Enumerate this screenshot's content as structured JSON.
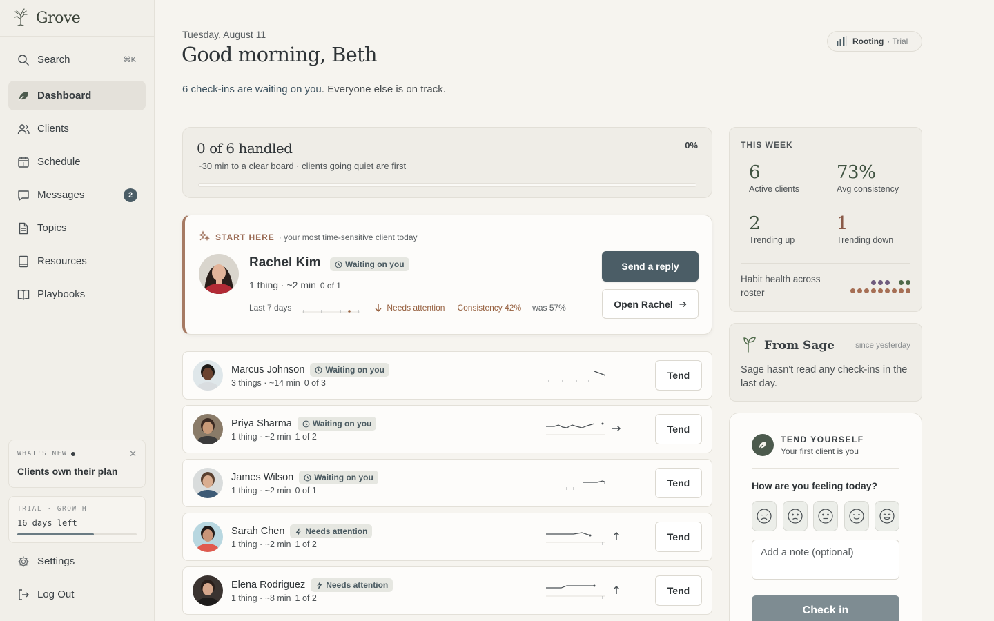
{
  "app": {
    "name": "Grove"
  },
  "sidebar": {
    "search": {
      "label": "Search",
      "shortcut": "⌘K"
    },
    "items": [
      {
        "label": "Dashboard",
        "icon": "leaf-icon",
        "active": true
      },
      {
        "label": "Clients",
        "icon": "users-icon"
      },
      {
        "label": "Schedule",
        "icon": "calendar-icon"
      },
      {
        "label": "Messages",
        "icon": "message-icon",
        "badge": "2"
      },
      {
        "label": "Topics",
        "icon": "document-icon"
      },
      {
        "label": "Resources",
        "icon": "tablet-icon"
      },
      {
        "label": "Playbooks",
        "icon": "book-icon"
      }
    ],
    "whats_new": {
      "label": "WHAT'S NEW",
      "title": "Clients own their plan"
    },
    "trial": {
      "label": "TRIAL · GROWTH",
      "days": "16 days left",
      "progress": 0.64
    },
    "settings": "Settings",
    "logout": "Log Out"
  },
  "header": {
    "date": "Tuesday, August 11",
    "greeting": "Good morning, Beth",
    "waiting_link": "6 check-ins are waiting on you",
    "waiting_rest": ". Everyone else is on track.",
    "plan": {
      "name": "Rooting",
      "tier": "· Trial"
    }
  },
  "progress": {
    "title": "0 of 6 handled",
    "subtitle": "~30 min to a clear board · clients going quiet are first",
    "percent": "0%",
    "value": 0
  },
  "start_here": {
    "label": "START HERE",
    "description": "· your most time-sensitive client today",
    "name": "Rachel Kim",
    "status": "Waiting on you",
    "meta": "1 thing · ~2 min",
    "of": "0 of 1",
    "last_days": "Last 7 days",
    "attention": "Needs attention",
    "consistency": "Consistency 42%",
    "was": "was 57%",
    "reply_button": "Send a reply",
    "open_button": "Open Rachel"
  },
  "clients": [
    {
      "name": "Marcus Johnson",
      "status": "Waiting on you",
      "status_type": "waiting",
      "meta": "3 things · ~14 min",
      "of": "0 of 3",
      "trend": "down",
      "tend": "Tend"
    },
    {
      "name": "Priya Sharma",
      "status": "Waiting on you",
      "status_type": "waiting",
      "meta": "1 thing · ~2 min",
      "of": "1 of 2",
      "trend": "flat",
      "tend": "Tend"
    },
    {
      "name": "James Wilson",
      "status": "Waiting on you",
      "status_type": "waiting",
      "meta": "1 thing · ~2 min",
      "of": "0 of 1",
      "trend": "none",
      "tend": "Tend"
    },
    {
      "name": "Sarah Chen",
      "status": "Needs attention",
      "status_type": "attention",
      "meta": "1 thing · ~2 min",
      "of": "1 of 2",
      "trend": "up",
      "tend": "Tend"
    },
    {
      "name": "Elena Rodriguez",
      "status": "Needs attention",
      "status_type": "attention",
      "meta": "1 thing · ~8 min",
      "of": "1 of 2",
      "trend": "up",
      "tend": "Tend"
    }
  ],
  "this_week": {
    "title": "THIS WEEK",
    "stats": [
      {
        "value": "6",
        "label": "Active clients"
      },
      {
        "value": "73%",
        "label": "Avg consistency"
      },
      {
        "value": "2",
        "label": "Trending up"
      },
      {
        "value": "1",
        "label": "Trending down"
      }
    ],
    "habit_label": "Habit health across roster"
  },
  "sage": {
    "title": "From Sage",
    "since": "since yesterday",
    "body": "Sage hasn't read any check-ins in the last day."
  },
  "tend_yourself": {
    "title": "TEND YOURSELF",
    "subtitle": "Your first client is you",
    "question": "How are you feeling today?",
    "moods": [
      "very-sad-face-icon",
      "sad-face-icon",
      "neutral-face-icon",
      "content-face-icon",
      "happy-face-icon"
    ],
    "note_placeholder": "Add a note (optional)",
    "checkin_button": "Check in"
  },
  "colors": {
    "accent": "#4b5d66",
    "attention": "#96603f",
    "start_border": "#a67a63",
    "positive": "#3f5240"
  }
}
